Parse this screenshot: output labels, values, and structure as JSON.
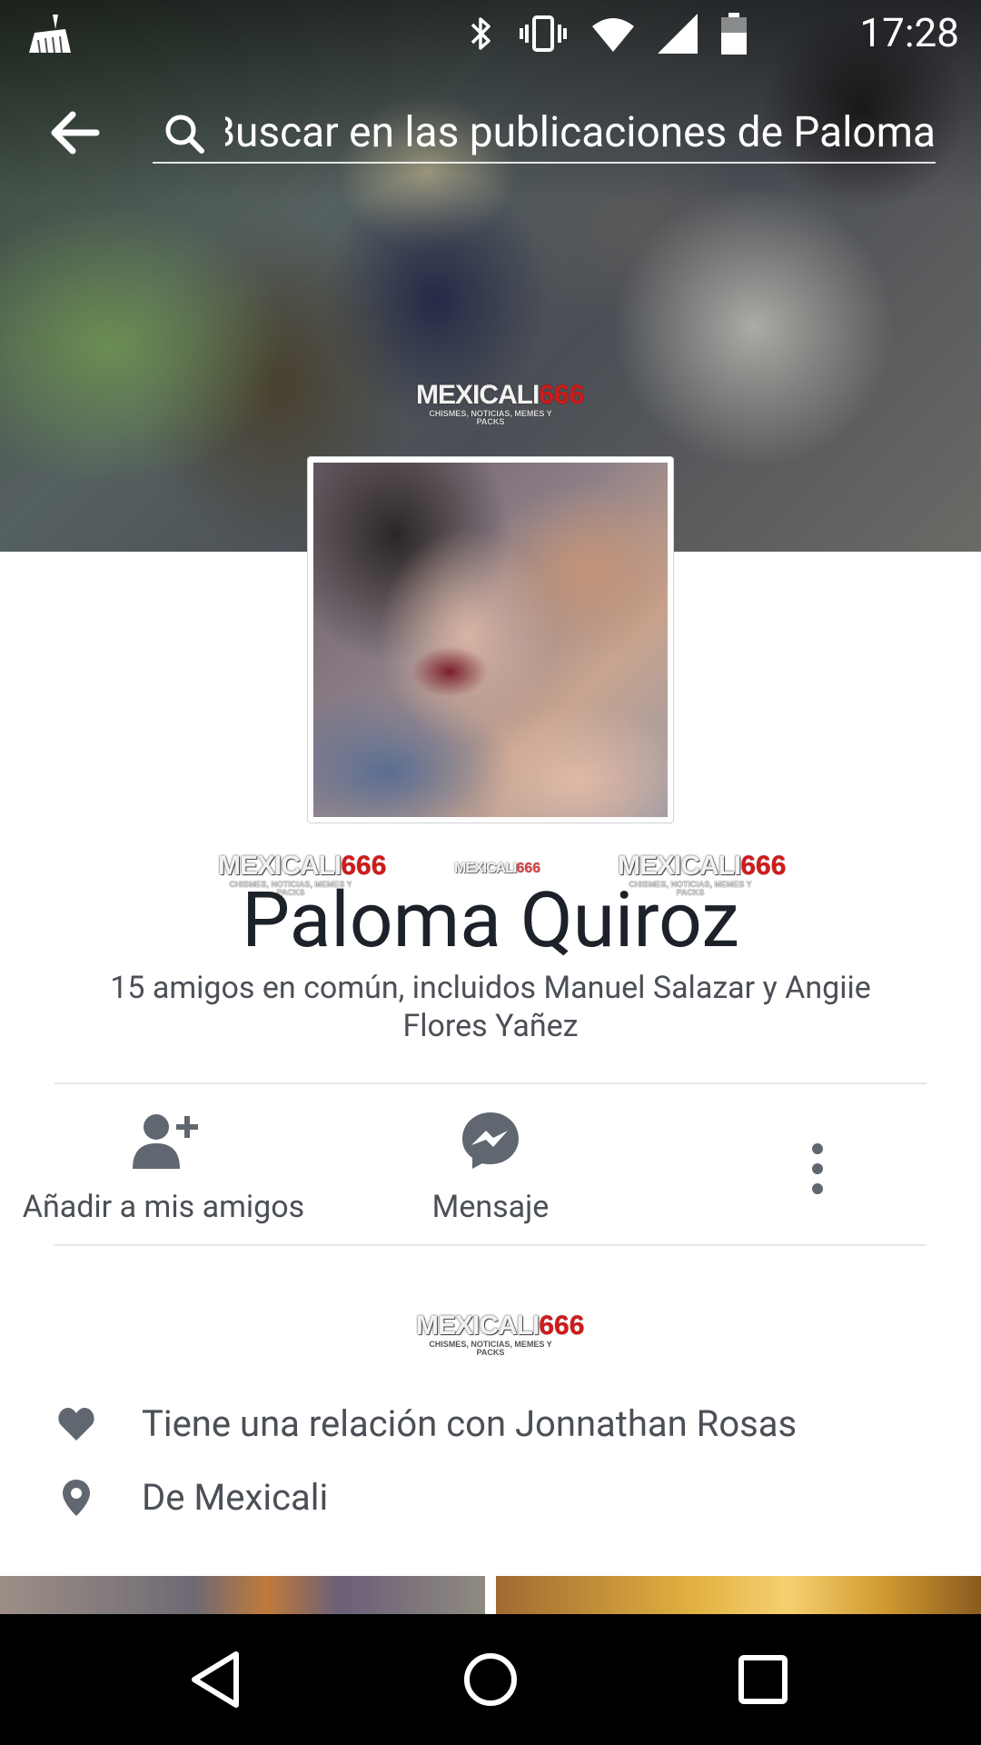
{
  "status_bar": {
    "time": "17:28"
  },
  "search": {
    "text": "Buscar en las publicaciones de Paloma"
  },
  "watermark": {
    "brand_main": "MEXICALI",
    "brand_num": "666",
    "tagline": "CHISMES, NOTICIAS, MEMES Y PACKS"
  },
  "profile": {
    "name": "Paloma Quiroz",
    "mutual_friends": "15 amigos en común, incluidos Manuel Salazar y Angiie Flores Yañez"
  },
  "actions": {
    "add_friend": "Añadir a mis amigos",
    "message": "Mensaje"
  },
  "info": {
    "relationship": "Tiene una relación con Jonnathan Rosas",
    "location": "De Mexicali"
  },
  "colors": {
    "text_primary": "#1d2129",
    "text_secondary": "#4b4f56",
    "icon_gray": "#606770",
    "divider": "#e5e6e9"
  }
}
